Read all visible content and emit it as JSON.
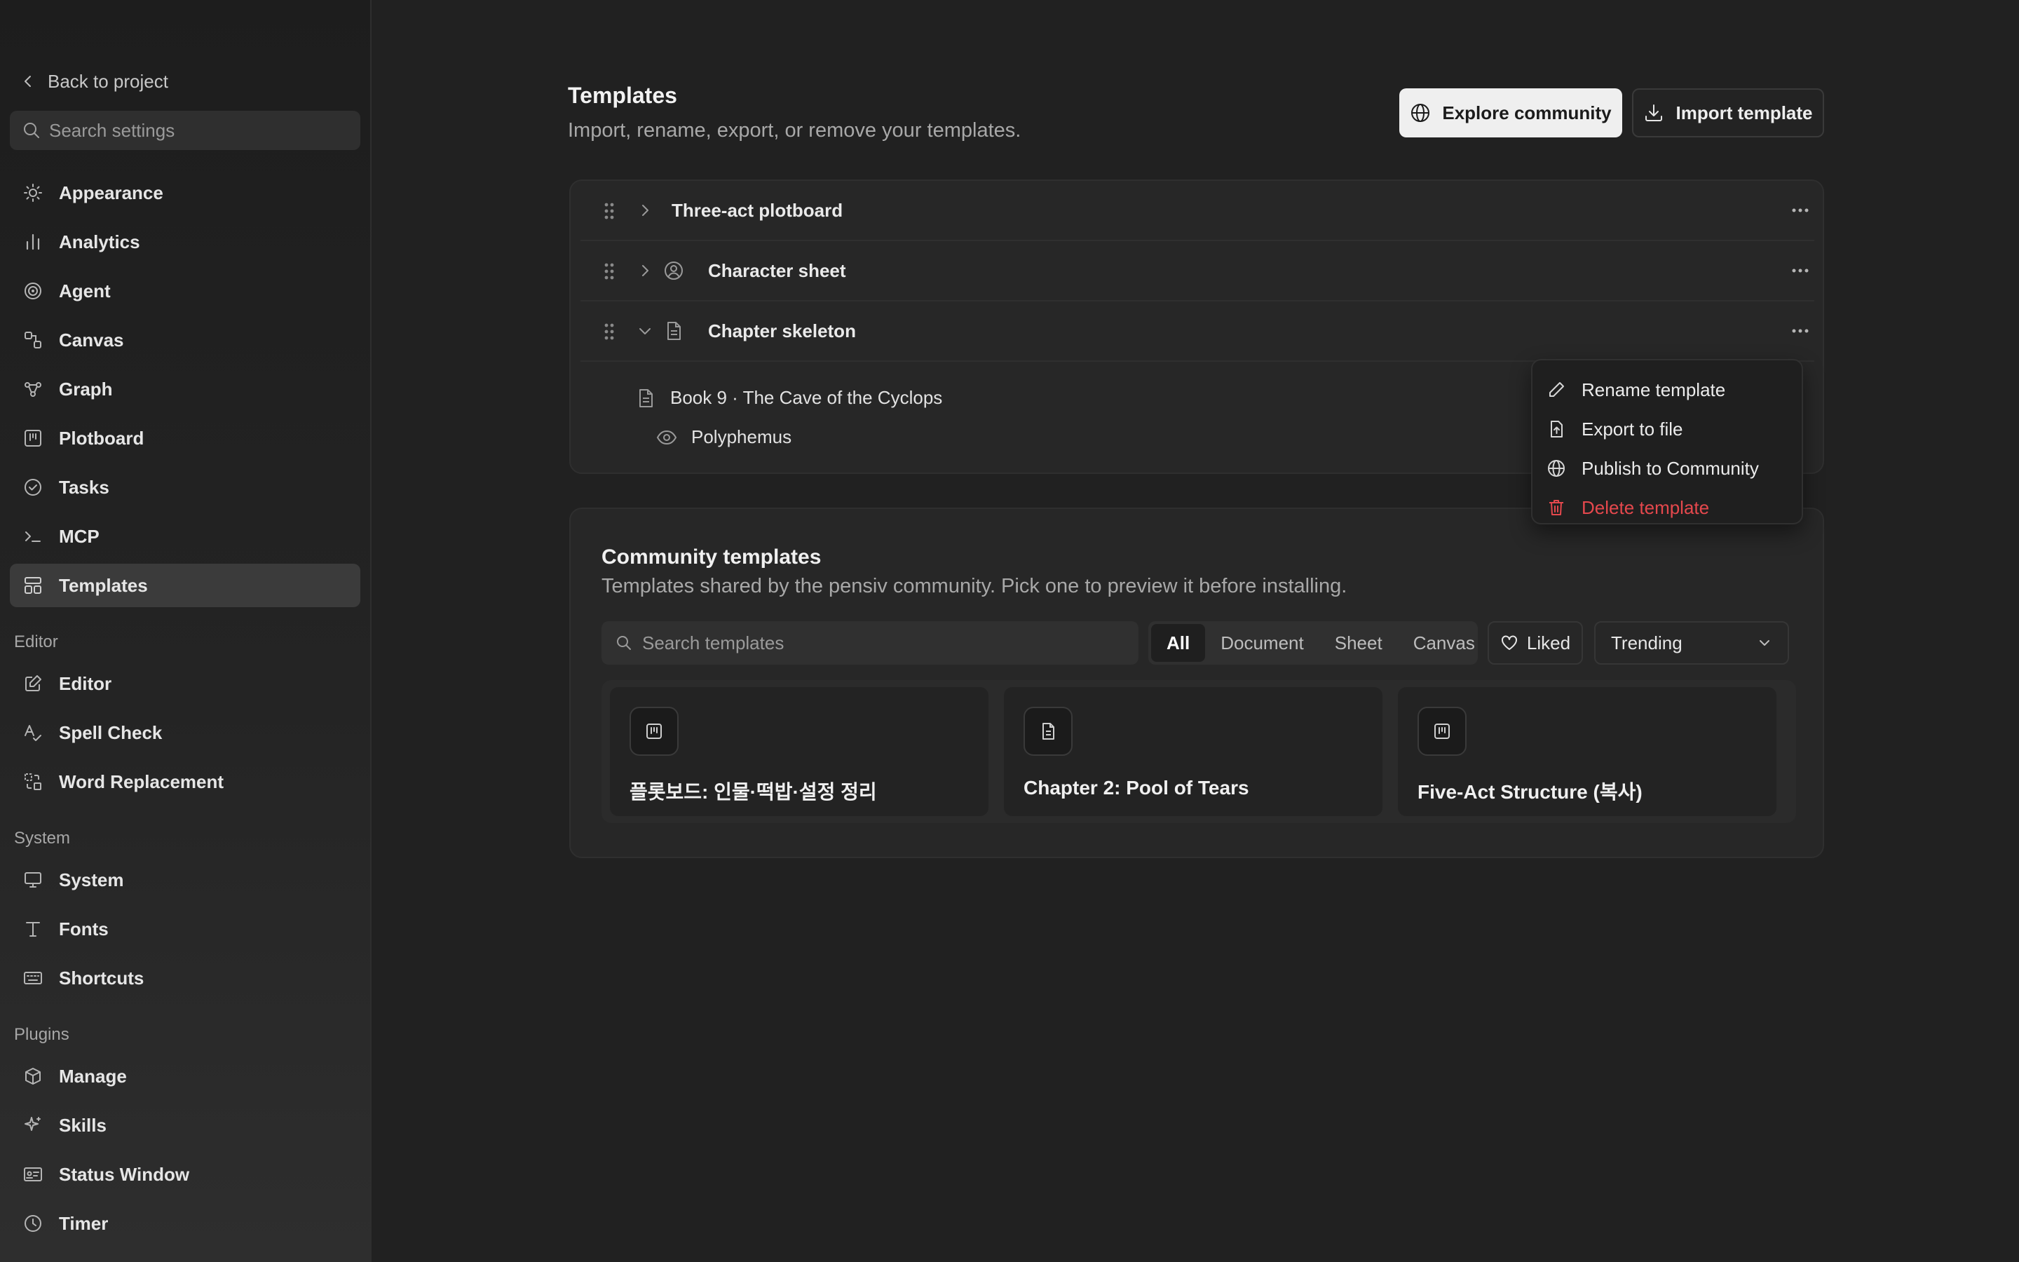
{
  "sidebar": {
    "back_label": "Back to project",
    "search_placeholder": "Search settings",
    "items": [
      {
        "label": "Appearance"
      },
      {
        "label": "Analytics"
      },
      {
        "label": "Agent"
      },
      {
        "label": "Canvas"
      },
      {
        "label": "Graph"
      },
      {
        "label": "Plotboard"
      },
      {
        "label": "Tasks"
      },
      {
        "label": "MCP"
      },
      {
        "label": "Templates"
      }
    ],
    "editor_section": "Editor",
    "editor_items": [
      {
        "label": "Editor"
      },
      {
        "label": "Spell Check"
      },
      {
        "label": "Word Replacement"
      }
    ],
    "system_section": "System",
    "system_items": [
      {
        "label": "System"
      },
      {
        "label": "Fonts"
      },
      {
        "label": "Shortcuts"
      }
    ],
    "plugins_section": "Plugins",
    "plugins_items": [
      {
        "label": "Manage"
      },
      {
        "label": "Skills"
      },
      {
        "label": "Status Window"
      },
      {
        "label": "Timer"
      }
    ]
  },
  "header": {
    "title": "Templates",
    "subtitle": "Import, rename, export, or remove your templates.",
    "explore_label": "Explore community",
    "import_label": "Import template"
  },
  "templates": [
    {
      "name": "Three-act plotboard"
    },
    {
      "name": "Character sheet"
    },
    {
      "name": "Chapter skeleton",
      "children": [
        {
          "name": "Book 9 · The Cave of the Cyclops"
        },
        {
          "name": "Polyphemus"
        }
      ]
    }
  ],
  "context_menu": {
    "rename": "Rename template",
    "export": "Export to file",
    "publish": "Publish to Community",
    "delete": "Delete template"
  },
  "community": {
    "title": "Community templates",
    "subtitle": "Templates shared by the pensiv community. Pick one to preview it before installing.",
    "search_placeholder": "Search templates",
    "filters": [
      "All",
      "Document",
      "Sheet",
      "Canvas"
    ],
    "liked_label": "Liked",
    "sort_value": "Trending",
    "cards": [
      {
        "title": "플롯보드: 인물·떡밥·설정 정리",
        "icon": "plotboard-icon"
      },
      {
        "title": "Chapter 2: Pool of Tears",
        "icon": "document-icon"
      },
      {
        "title": "Five-Act Structure (복사)",
        "icon": "plotboard-icon"
      }
    ]
  },
  "colors": {
    "background": "#212121",
    "sidebar": "#1d1d1d",
    "danger": "#e5484d",
    "primary_button": "#efefef"
  }
}
